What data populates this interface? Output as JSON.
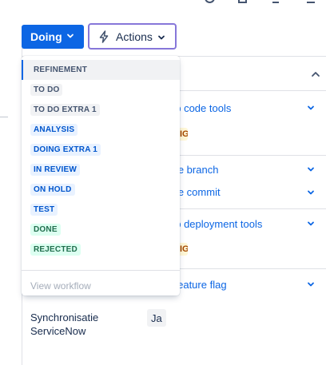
{
  "toolbar": {
    "status_label": "Doing",
    "actions_label": "Actions"
  },
  "dropdown": {
    "items": [
      {
        "label": "REFINEMENT",
        "color": "#44546f"
      },
      {
        "label": "TO DO",
        "color": "#44546f"
      },
      {
        "label": "TO DO EXTRA 1",
        "color": "#44546f"
      },
      {
        "label": "ANALYSIS",
        "color": "#0055cc"
      },
      {
        "label": "DOING EXTRA 1",
        "color": "#0055cc"
      },
      {
        "label": "IN REVIEW",
        "color": "#0055cc"
      },
      {
        "label": "ON HOLD",
        "color": "#0055cc"
      },
      {
        "label": "TEST",
        "color": "#0055cc"
      },
      {
        "label": "DONE",
        "color": "#216e4e"
      },
      {
        "label": "REJECTED",
        "color": "#216e4e"
      }
    ],
    "footer": "View workflow"
  },
  "tasks": [
    {
      "label": "up code tools",
      "status": "IG"
    },
    {
      "label": "ate branch"
    },
    {
      "label": "ate commit"
    },
    {
      "label": "up deployment tools",
      "status": "IG"
    },
    {
      "label": "l feature flag"
    }
  ],
  "field": {
    "label": "Synchronisatie ServiceNow",
    "value": "Ja"
  },
  "colors": {
    "primary": "#0c66e4",
    "actions_border": "#8777d9"
  }
}
